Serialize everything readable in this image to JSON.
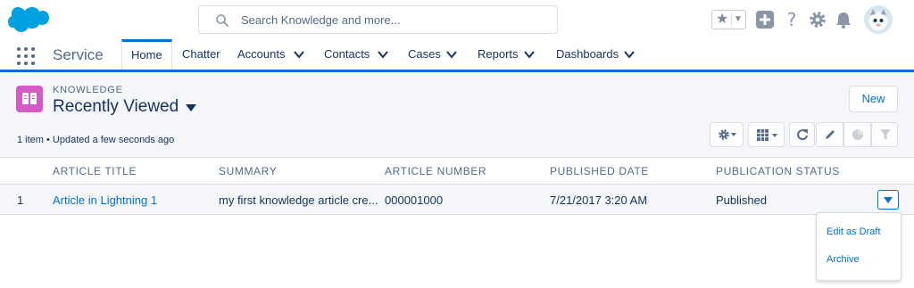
{
  "header": {
    "search_placeholder": "Search Knowledge and more...",
    "icons": [
      "salesforce-logo",
      "search-icon",
      "star-icon",
      "chevron-down-icon",
      "plus-icon",
      "help-icon",
      "gear-icon",
      "bell-icon",
      "avatar"
    ]
  },
  "nav": {
    "app_name": "Service",
    "tabs": [
      {
        "label": "Home",
        "active": true,
        "has_menu": false
      },
      {
        "label": "Chatter",
        "active": false,
        "has_menu": false
      },
      {
        "label": "Accounts",
        "active": false,
        "has_menu": true
      },
      {
        "label": "Contacts",
        "active": false,
        "has_menu": true
      },
      {
        "label": "Cases",
        "active": false,
        "has_menu": true
      },
      {
        "label": "Reports",
        "active": false,
        "has_menu": true
      },
      {
        "label": "Dashboards",
        "active": false,
        "has_menu": true
      }
    ]
  },
  "list_view": {
    "object_label": "KNOWLEDGE",
    "title": "Recently Viewed",
    "meta": "1 item • Updated a few seconds ago",
    "new_button": "New"
  },
  "table": {
    "columns": [
      "ARTICLE TITLE",
      "SUMMARY",
      "ARTICLE NUMBER",
      "PUBLISHED DATE",
      "PUBLICATION STATUS"
    ],
    "rows": [
      {
        "num": "1",
        "title": "Article in Lightning 1",
        "summary": "my first knowledge article cre...",
        "number": "000001000",
        "published_date": "7/21/2017 3:20 AM",
        "status": "Published"
      }
    ]
  },
  "row_menu": {
    "items": [
      "Edit as Draft",
      "Archive"
    ]
  },
  "colors": {
    "brand_blue": "#0070d2",
    "knowledge_icon": "#d45ac6",
    "text": "#16325c",
    "muted": "#54698d"
  }
}
